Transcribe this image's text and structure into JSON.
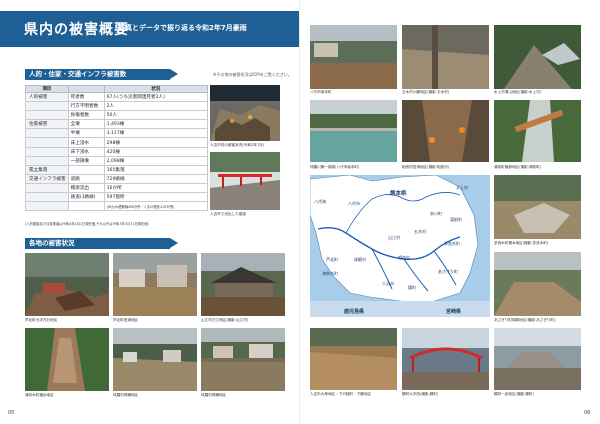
{
  "title": "県内の被害概要",
  "subtitle": "写真とデータで振り返る令和2年7月豪雨",
  "sections": {
    "infra": "人的・住家・交通インフラ被害数",
    "infra_note": "※その他の被害状況はP29をご覧ください。",
    "areas": "各地の被害状況"
  },
  "table": {
    "headers": [
      "項目",
      "",
      "状況"
    ],
    "rows": [
      {
        "cat": "人的被害",
        "item": "死者数",
        "value": "67人(うち災害関連死者2人)"
      },
      {
        "cat": "",
        "item": "行方不明者数",
        "value": "2人"
      },
      {
        "cat": "",
        "item": "負傷者数",
        "value": "50人"
      },
      {
        "cat": "住家被害",
        "item": "全壊",
        "value": "1,493棟"
      },
      {
        "cat": "",
        "item": "半壊",
        "value": "3,117棟"
      },
      {
        "cat": "",
        "item": "床上浸水",
        "value": "298棟"
      },
      {
        "cat": "",
        "item": "床下浸水",
        "value": "420棟"
      },
      {
        "cat": "",
        "item": "一部損壊",
        "value": "2,098棟"
      },
      {
        "cat": "孤立集落",
        "item": "",
        "value": "165集落"
      },
      {
        "cat": "交通インフラ被害",
        "item": "道路",
        "value": "729路線"
      },
      {
        "cat": "",
        "item": "橋梁流出",
        "value": "16か所"
      },
      {
        "cat": "",
        "item": "鉄道(3路線)",
        "value": "597箇所"
      }
    ],
    "rail_note": "(JR九州:肥薩線450か所・くま川鉄道:147か所)"
  },
  "footnote": "(人的被害及び住家被害は令和4年4月1日現在値,それ以外は令和3年3月31日現在値)",
  "photos_left": [
    {
      "caption": "人吉市内の被害状況(令和2年7月)"
    },
    {
      "caption": "人吉市で流出した橋梁"
    },
    {
      "caption": "芦北町大字白石地区"
    },
    {
      "caption": "芦北町田浦地区"
    },
    {
      "caption": "山江村万江地区(撮影:山江村)"
    },
    {
      "caption": "津奈木町福浜地区"
    },
    {
      "caption": "球磨村神瀬地区"
    },
    {
      "caption": "球磨村神瀬地区"
    }
  ],
  "photos_right": [
    {
      "caption": "八代市坂本町"
    },
    {
      "caption": "五木村小鶴地区(撮影:五木村)"
    },
    {
      "caption": "水上村湯山地区(撮影:水上村)"
    },
    {
      "caption": "球磨川第一橋梁(八代市坂本町)"
    },
    {
      "caption": "相良村四浦地区(撮影:相良村)"
    },
    {
      "caption": "湯前町植柳地区(撮影:湯前町)"
    },
    {
      "caption": "多良木町槻木地区(撮影:多良木町)"
    },
    {
      "caption": "あさぎり町岡原地区(撮影:あさぎり町)"
    },
    {
      "caption": "人吉市大柿地区・下戸越町・下鶴地区"
    },
    {
      "caption": "錦町大字西(撮影:錦町)"
    },
    {
      "caption": "錦町一武地区(撮影:錦町)"
    }
  ],
  "map": {
    "labels": [
      "熊本県",
      "八代市",
      "芦北町",
      "津奈木町",
      "山江村",
      "球磨村",
      "人吉市",
      "相良村",
      "五木村",
      "錦町",
      "あさぎり町",
      "多良木町",
      "湯前町",
      "水上村",
      "氷川町",
      "鹿児島県",
      "宮崎県",
      "八代海"
    ]
  },
  "page_numbers": {
    "left": "05",
    "right": "06"
  },
  "colors": {
    "brand": "#1e5f95",
    "map_land": "#a8cdea",
    "river": "#1b5fb5",
    "kumamoto_land": "#ffffff"
  }
}
